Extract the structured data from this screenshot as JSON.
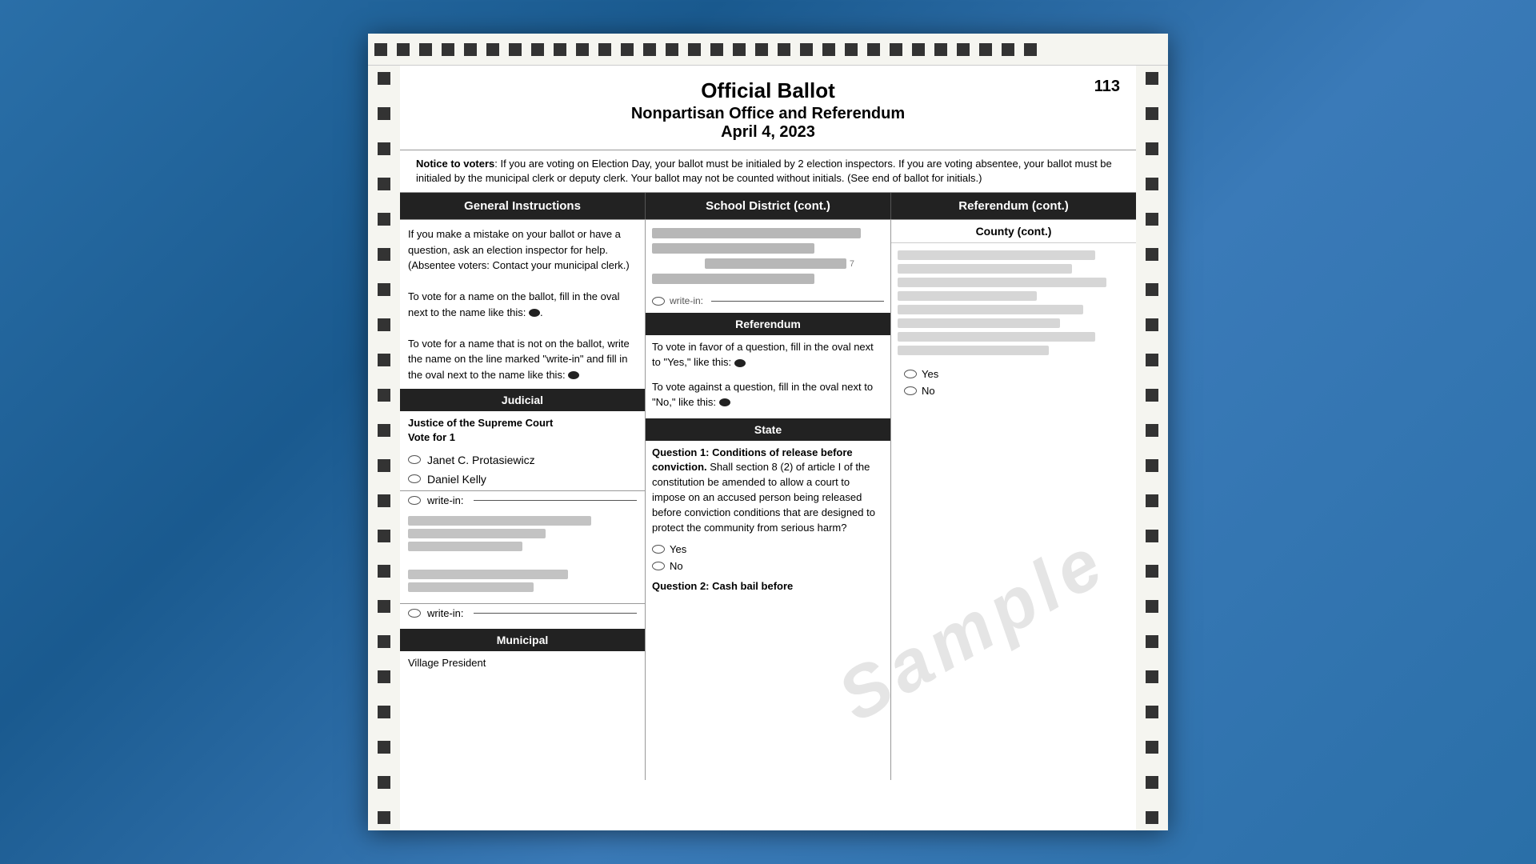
{
  "page": {
    "background": "#2a6fa8",
    "page_number": "113",
    "ballot_title": "Official Ballot",
    "ballot_subtitle": "Nonpartisan Office and Referendum",
    "ballot_date": "April 4, 2023",
    "notice_label": "Notice to voters",
    "notice_text": ": If you are voting on Election Day, your ballot must be initialed by 2 election inspectors.  If you are voting absentee, your ballot must be initialed by the municipal clerk or deputy clerk.  Your ballot may not be counted without initials.  (See end of ballot for initials.)",
    "sample_watermark": "Sample"
  },
  "columns": {
    "col1_header": "General Instructions",
    "col2_header": "School District (cont.)",
    "col3_header": "Referendum (cont.)"
  },
  "instructions": {
    "para1": "If you make a mistake on your ballot or have a question, ask an election inspector for help. (Absentee voters: Contact your municipal clerk.)",
    "para2_pre": "To vote for a name on the ballot, fill in the oval next to the name like this:",
    "para3_pre": "To vote for a name that is not on the ballot, write the name on the line marked \"write-in\" and fill in the oval next to the name like this:"
  },
  "judicial_section": {
    "header": "Judicial",
    "race_title": "Justice of the Supreme Court",
    "race_instruction": "Vote for 1",
    "candidates": [
      {
        "name": "Janet C. Protasiewicz",
        "row": "42"
      },
      {
        "name": "Daniel Kelly",
        "row": "43"
      }
    ],
    "write_in_label": "write-in:",
    "row42": "42",
    "row43": "43",
    "row44": "44"
  },
  "school_district": {
    "write_in_label": "write-in:",
    "referendum_header": "Referendum",
    "referendum_para1_pre": "To vote in favor of a question, fill in the oval next to \"Yes,\" like this:",
    "referendum_para2_pre": "To vote against a question, fill in the oval next to \"No,\" like this:",
    "state_header": "State",
    "question1_title": "Question 1: Conditions of release before conviction.",
    "question1_body": " Shall section 8 (2) of article I of the constitution be amended to allow a court to impose on an accused person being released before conviction conditions that are designed to protect the community from serious harm?",
    "question1_yes": "Yes",
    "question1_no": "No",
    "question2_title": "Question 2: Cash bail before"
  },
  "referendum_cont": {
    "county_cont_header": "County (cont.)",
    "yes_label": "Yes",
    "no_label": "No"
  },
  "municipal": {
    "header": "Municipal",
    "village_president": "Village President"
  }
}
